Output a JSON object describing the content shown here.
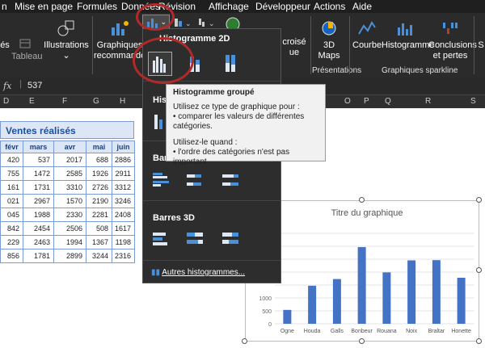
{
  "menu": [
    "n",
    "Mise en page",
    "Formules",
    "Données",
    "Révision",
    "Affichage",
    "Développeur",
    "Actions",
    "Aide"
  ],
  "ribbon": {
    "left_partial": "és",
    "tableau": "Tableau",
    "illustrations": "Illustrations",
    "recommended": [
      "Graphiques",
      "recommandés"
    ],
    "crosstab": [
      "croisé",
      "ue"
    ],
    "maps3d": [
      "3D",
      "Maps"
    ],
    "presentations": "Présentations",
    "sparkline_line": "Courbe",
    "sparkline_hist": "Histogramme",
    "sparkline_wl": [
      "Conclusions",
      "et pertes"
    ],
    "sparkline_group": "Graphiques sparkline",
    "right_partial": "S"
  },
  "formula": {
    "fx": "fx",
    "value": "537"
  },
  "columns": [
    "D",
    "E",
    "F",
    "G",
    "H",
    "O",
    "P",
    "Q",
    "R",
    "S"
  ],
  "sheet": {
    "title": "Ventes réalisés",
    "headers": [
      "févr",
      "mars",
      "avr",
      "mai",
      "juin"
    ],
    "rows": [
      [
        "420",
        "537",
        "2017",
        "688",
        "2886"
      ],
      [
        "755",
        "1472",
        "2585",
        "1926",
        "2911"
      ],
      [
        "161",
        "1731",
        "3310",
        "2726",
        "3312"
      ],
      [
        "021",
        "2967",
        "1570",
        "2190",
        "3246"
      ],
      [
        "045",
        "1988",
        "2330",
        "2281",
        "2408"
      ],
      [
        "842",
        "2454",
        "2506",
        "508",
        "1617"
      ],
      [
        "229",
        "2463",
        "1994",
        "1367",
        "1198"
      ],
      [
        "856",
        "1781",
        "2899",
        "3244",
        "2316"
      ]
    ]
  },
  "dropdown": {
    "section1": "Histogramme 2D",
    "section2": "Histo",
    "section3": "Barres",
    "section4": "Barres 3D",
    "more": "Autres histogrammes..."
  },
  "tooltip": {
    "title": "Histogramme groupé",
    "line1": "Utilisez ce type de graphique pour :",
    "line2": "• comparer les valeurs de différentes catégories.",
    "line3": "Utilisez-le quand :",
    "line4": "• l'ordre des catégories n'est pas important."
  },
  "chart_data": {
    "type": "bar",
    "title": "Titre du graphique",
    "categories": [
      "Ogne",
      "Houda",
      "Galls",
      "Bonbeur",
      "Rouana",
      "Noix",
      "Braltar",
      "Honette"
    ],
    "values": [
      537,
      1472,
      1731,
      2967,
      1988,
      2454,
      2463,
      1781
    ],
    "ylim": [
      0,
      3500
    ],
    "yticks_visible": [
      "1000",
      "500",
      "0"
    ],
    "bar_color": "#4472c4"
  },
  "colors": {
    "accent_red": "#b02a2a",
    "ribbon": "#2b2b2b",
    "bar": "#4472c4"
  }
}
